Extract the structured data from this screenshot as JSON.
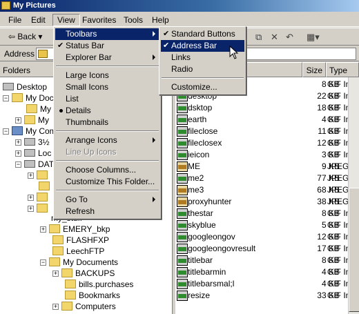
{
  "window": {
    "title": "My Pictures"
  },
  "menubar": {
    "items": [
      "File",
      "Edit",
      "View",
      "Favorites",
      "Tools",
      "Help"
    ]
  },
  "toolbar": {
    "back_label": "Back"
  },
  "address": {
    "label": "Address"
  },
  "folders": {
    "header": "Folders",
    "tree": [
      "Desktop",
      "My Doc",
      "My",
      "My",
      "My Com",
      "3½",
      "Loc",
      "DAT",
      "my_stuff",
      "EMERY_bkp",
      "FLASHFXP",
      "LeechFTP",
      "My Documents",
      "BACKUPS",
      "bills.purchases",
      "Bookmarks",
      "Computers"
    ]
  },
  "files": {
    "columns": {
      "size": "Size",
      "type": "Type"
    },
    "rows": [
      {
        "name": "",
        "size": "8 KB",
        "type": "GIF Image",
        "kind": "gif"
      },
      {
        "name": "desktop",
        "size": "22 KB",
        "type": "GIF Image",
        "kind": "gif"
      },
      {
        "name": "dsktop",
        "size": "18 KB",
        "type": "GIF Image",
        "kind": "gif"
      },
      {
        "name": "earth",
        "size": "4 KB",
        "type": "GIF Image",
        "kind": "gif"
      },
      {
        "name": "fileclose",
        "size": "11 KB",
        "type": "GIF Image",
        "kind": "gif"
      },
      {
        "name": "fileclosex",
        "size": "12 KB",
        "type": "GIF Image",
        "kind": "gif"
      },
      {
        "name": "ieicon",
        "size": "3 KB",
        "type": "GIF Image",
        "kind": "gif"
      },
      {
        "name": "ME",
        "size": "9 KB",
        "type": "JPEG Ima",
        "kind": "jpg"
      },
      {
        "name": "me2",
        "size": "77 KB",
        "type": "JPEG Ima",
        "kind": "gif"
      },
      {
        "name": "me3",
        "size": "68 KB",
        "type": "JPEG Ima",
        "kind": "jpg"
      },
      {
        "name": "proxyhunter",
        "size": "38 KB",
        "type": "JPEG Ima",
        "kind": "jpg"
      },
      {
        "name": "thestar",
        "size": "8 KB",
        "type": "GIF Image",
        "kind": "gif"
      },
      {
        "name": "skyblue",
        "size": "5 KB",
        "type": "GIF Image",
        "kind": "gif"
      },
      {
        "name": "googleongov",
        "size": "12 KB",
        "type": "GIF Image",
        "kind": "gif"
      },
      {
        "name": "googleongovresult",
        "size": "17 KB",
        "type": "GIF Image",
        "kind": "gif"
      },
      {
        "name": "titlebar",
        "size": "8 KB",
        "type": "GIF Image",
        "kind": "gif"
      },
      {
        "name": "titlebarmin",
        "size": "4 KB",
        "type": "GIF Image",
        "kind": "gif"
      },
      {
        "name": "titlebarsmal;l",
        "size": "4 KB",
        "type": "GIF Image",
        "kind": "gif"
      },
      {
        "name": "resize",
        "size": "33 KB",
        "type": "GIF Image",
        "kind": "gif"
      }
    ]
  },
  "view_menu": {
    "items": [
      "Toolbars",
      "Status Bar",
      "Explorer Bar",
      "Large Icons",
      "Small Icons",
      "List",
      "Details",
      "Thumbnails",
      "Arrange Icons",
      "Line Up Icons",
      "Choose Columns...",
      "Customize This Folder...",
      "Go To",
      "Refresh"
    ]
  },
  "toolbars_submenu": {
    "items": [
      "Standard Buttons",
      "Address Bar",
      "Links",
      "Radio",
      "Customize..."
    ]
  }
}
